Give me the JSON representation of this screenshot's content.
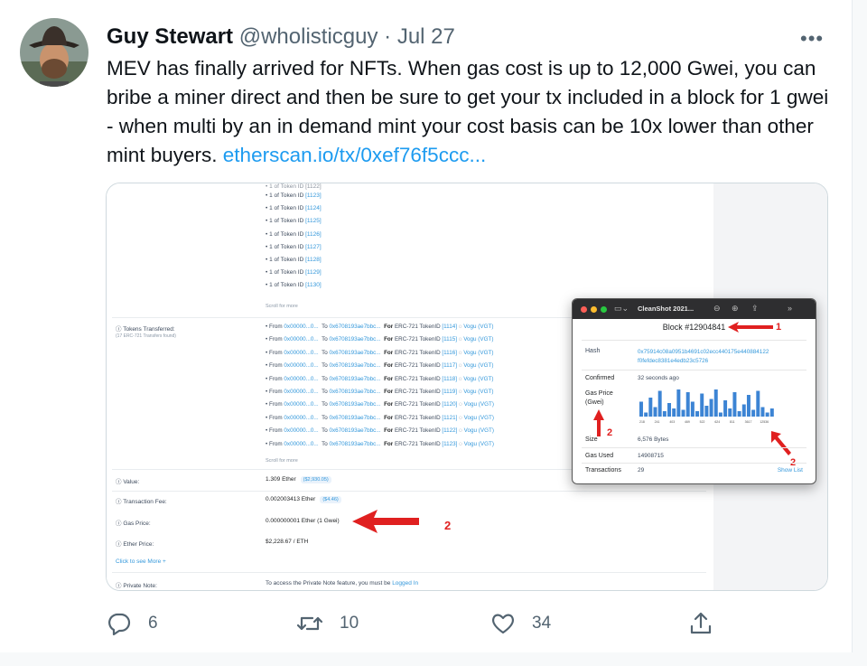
{
  "tweet": {
    "author_name": "Guy Stewart",
    "handle": "@wholisticguy",
    "separator": "·",
    "date": "Jul 27",
    "more_icon": "more-horizontal-icon",
    "text": "MEV has finally arrived for NFTs. When gas cost is up to 12,000 Gwei, you can bribe a miner direct and then be sure to get your tx included in a block for 1 gwei - when multi by an in demand mint your cost basis can be 10x lower than other mint buyers. ",
    "link_text": "etherscan.io/tx/0xef76f5ccc...",
    "link_color": "#1d9bf0"
  },
  "etherscan": {
    "token_items": [
      {
        "prefix": "1 of Token ID",
        "id": "[1123]"
      },
      {
        "prefix": "1 of Token ID",
        "id": "[1124]"
      },
      {
        "prefix": "1 of Token ID",
        "id": "[1125]"
      },
      {
        "prefix": "1 of Token ID",
        "id": "[1126]"
      },
      {
        "prefix": "1 of Token ID",
        "id": "[1127]"
      },
      {
        "prefix": "1 of Token ID",
        "id": "[1128]"
      },
      {
        "prefix": "1 of Token ID",
        "id": "[1129]"
      },
      {
        "prefix": "1 of Token ID",
        "id": "[1130]"
      }
    ],
    "scroll_more": "Scroll for more",
    "tokens_transferred_label": "Tokens Transferred:",
    "tokens_transferred_sub": "(17 ERC-721 Transfers found)",
    "transfers": [
      {
        "token_id": "[1114]"
      },
      {
        "token_id": "[1115]"
      },
      {
        "token_id": "[1116]"
      },
      {
        "token_id": "[1117]"
      },
      {
        "token_id": "[1118]"
      },
      {
        "token_id": "[1119]"
      },
      {
        "token_id": "[1120]"
      },
      {
        "token_id": "[1121]"
      },
      {
        "token_id": "[1122]"
      },
      {
        "token_id": "[1123]"
      }
    ],
    "transfer_from_label": "From",
    "transfer_from_addr": "0x00000...0...",
    "transfer_to_label": "To",
    "transfer_to_addr": "0x6708193ae7bbc...",
    "transfer_for_label": "For",
    "transfer_standard": "ERC-721 TokenID",
    "transfer_token": "Vogu (VGT)",
    "value_label": "Value:",
    "value": "1.309 Ether",
    "value_usd": "($2,930.05)",
    "fee_label": "Transaction Fee:",
    "fee": "0.002003413 Ether",
    "fee_usd": "($4.46)",
    "gas_price_label": "Gas Price:",
    "gas_price": "0.000000001 Ether (1 Gwei)",
    "ether_price_label": "Ether Price:",
    "ether_price": "$2,228.67 / ETH",
    "see_more": "Click to see More",
    "private_note_label": "Private Note:",
    "private_note_text": "To access the Private Note feature, you must be ",
    "private_note_link": "Logged In"
  },
  "cleanshot": {
    "title": "CleanShot 2021...",
    "block": "Block #12904841",
    "hash_label": "Hash",
    "hash_line1": "0x75914c08a0951b4691c02ecc440175e440884122",
    "hash_line2": "f0fefdec8381e4edb23c5726",
    "confirmed_label": "Confirmed",
    "confirmed_value": "32 seconds ago",
    "gas_price_label": "Gas Price",
    "gas_price_unit": "(Gwei)",
    "size_label": "Size",
    "size_value": "6,576 Bytes",
    "gas_used_label": "Gas Used",
    "gas_used_value": "14908715",
    "transactions_label": "Transactions",
    "transactions_value": "29",
    "show_list": "Show List",
    "bar_color": "#3c84d4",
    "histogram_bars": [
      0.55,
      0.15,
      0.7,
      0.35,
      0.95,
      0.2,
      0.5,
      0.3,
      1.0,
      0.25,
      0.9,
      0.55,
      0.2,
      0.85,
      0.4,
      0.65,
      1.0,
      0.15,
      0.6,
      0.3,
      0.9,
      0.2,
      0.45,
      0.8,
      0.25,
      0.95,
      0.35,
      0.15,
      0.3
    ],
    "axis_labels": [
      "218",
      "241",
      "403",
      "469",
      "522",
      "624",
      "811",
      "3617",
      "12536"
    ]
  },
  "annotations": {
    "arrow_color": "#e02020",
    "label_1": "1",
    "label_2": "2"
  },
  "actions": {
    "reply_count": "6",
    "retweet_count": "10",
    "like_count": "34"
  }
}
